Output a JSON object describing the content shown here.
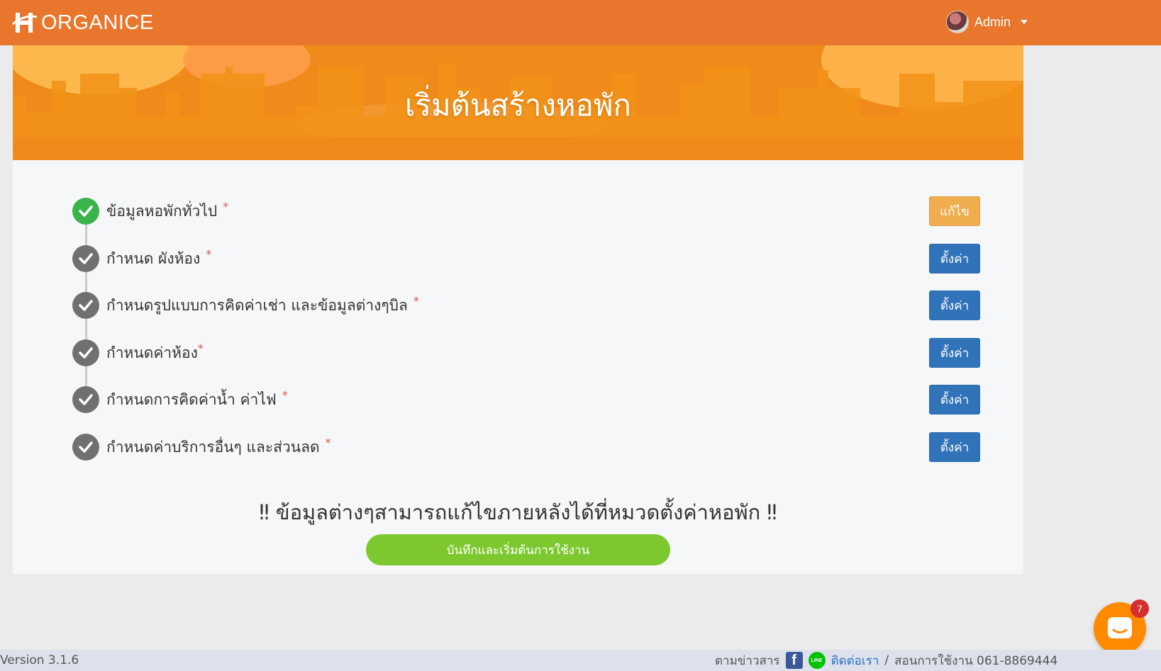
{
  "header": {
    "brand": "ORGANICE",
    "user_name": "Admin"
  },
  "banner": {
    "title": "เริ่มต้นสร้างหอพัก"
  },
  "steps": [
    {
      "label": "ข้อมูลหอพักทั่วไป",
      "required": "*",
      "status": "done",
      "button": "แก้ไข"
    },
    {
      "label": "กำหนด ผังห้อง",
      "required": "*",
      "status": "todo",
      "button": "ตั้งค่า"
    },
    {
      "label": "กำหนดรูปแบบการคิดค่าเช่า และข้อมูลต่างๆบิล",
      "required": "*",
      "status": "todo",
      "button": "ตั้งค่า"
    },
    {
      "label": "กำหนดค่าห้อง",
      "required": "*",
      "status": "todo",
      "button": "ตั้งค่า"
    },
    {
      "label": "กำหนดการคิดค่าน้ำ ค่าไฟ",
      "required": "*",
      "status": "todo",
      "button": "ตั้งค่า"
    },
    {
      "label": "กำหนดค่าบริการอื่นๆ และส่วนลด",
      "required": "*",
      "status": "todo",
      "button": "ตั้งค่า"
    }
  ],
  "notice": "‼ ข้อมูลต่างๆสามารถแก้ไขภายหลังได้ที่หมวดตั้งค่าหอพัก ‼",
  "cta_label": "บันทึกและเริ่มต้นการใช้งาน",
  "chat": {
    "badge_count": "7"
  },
  "footer": {
    "version": "Version 3.1.6",
    "news_label": "ตามข่าวสาร",
    "contact_label": "ติดต่อเรา",
    "separator": "/",
    "tutorial_label": "สอนการใช้งาน 061-8869444"
  },
  "colors": {
    "topbar": "#e8772d",
    "banner": "#f08a1a",
    "done": "#3ab44a",
    "edit_button": "#f0ad4e",
    "setup_button": "#3173b8",
    "cta": "#7ec82f"
  }
}
